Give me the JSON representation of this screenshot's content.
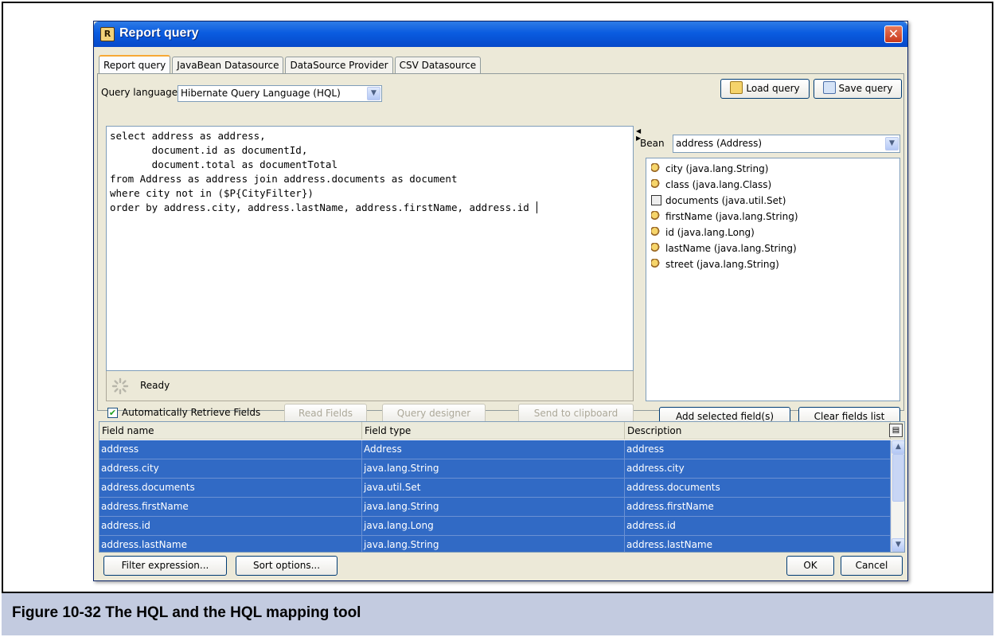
{
  "window": {
    "title": "Report query",
    "close_glyph": "✕"
  },
  "tabs": [
    {
      "label": "Report query",
      "active": true
    },
    {
      "label": "JavaBean Datasource"
    },
    {
      "label": "DataSource Provider"
    },
    {
      "label": "CSV Datasource"
    }
  ],
  "query": {
    "language_label": "Query language",
    "language_value": "Hibernate Query Language (HQL)",
    "load_label": "Load query",
    "save_label": "Save query",
    "lines": [
      "select address as address,",
      "       document.id as documentId,",
      "       document.total as documentTotal",
      "from Address as address join address.documents as document",
      "where city not in ($P{CityFilter})",
      "order by address.city, address.lastName, address.firstName, address.id "
    ],
    "status": "Ready"
  },
  "options": {
    "auto_retrieve_label": "Automatically Retrieve Fields",
    "auto_retrieve_checked": true,
    "read_fields": "Read Fields",
    "query_designer": "Query designer",
    "send_clipboard": "Send to clipboard"
  },
  "bean": {
    "label": "Bean",
    "value": "address (Address)",
    "items": [
      {
        "label": "city (java.lang.String)",
        "icon": "field-icon"
      },
      {
        "label": "class (java.lang.Class)",
        "icon": "field-icon"
      },
      {
        "label": "documents (java.util.Set)",
        "icon": "collection-icon"
      },
      {
        "label": "firstName (java.lang.String)",
        "icon": "field-icon"
      },
      {
        "label": "id (java.lang.Long)",
        "icon": "field-icon"
      },
      {
        "label": "lastName (java.lang.String)",
        "icon": "field-icon"
      },
      {
        "label": "street (java.lang.String)",
        "icon": "field-icon"
      }
    ],
    "add_selected": "Add selected field(s)",
    "clear_list": "Clear fields list"
  },
  "fields_table": {
    "columns": [
      "Field name",
      "Field type",
      "Description"
    ],
    "rows": [
      [
        "address",
        "Address",
        "address"
      ],
      [
        "address.city",
        "java.lang.String",
        "address.city"
      ],
      [
        "address.documents",
        "java.util.Set",
        "address.documents"
      ],
      [
        "address.firstName",
        "java.lang.String",
        "address.firstName"
      ],
      [
        "address.id",
        "java.lang.Long",
        "address.id"
      ],
      [
        "address.lastName",
        "java.lang.String",
        "address.lastName"
      ]
    ]
  },
  "footer": {
    "filter_expression": "Filter expression...",
    "sort_options": "Sort options...",
    "ok": "OK",
    "cancel": "Cancel"
  },
  "caption": "Figure 10-32  The HQL and the HQL mapping tool",
  "colors": {
    "selection": "#316ac5",
    "titlebar": "#0a5ce0",
    "caption_bg": "#c3cbe0"
  }
}
